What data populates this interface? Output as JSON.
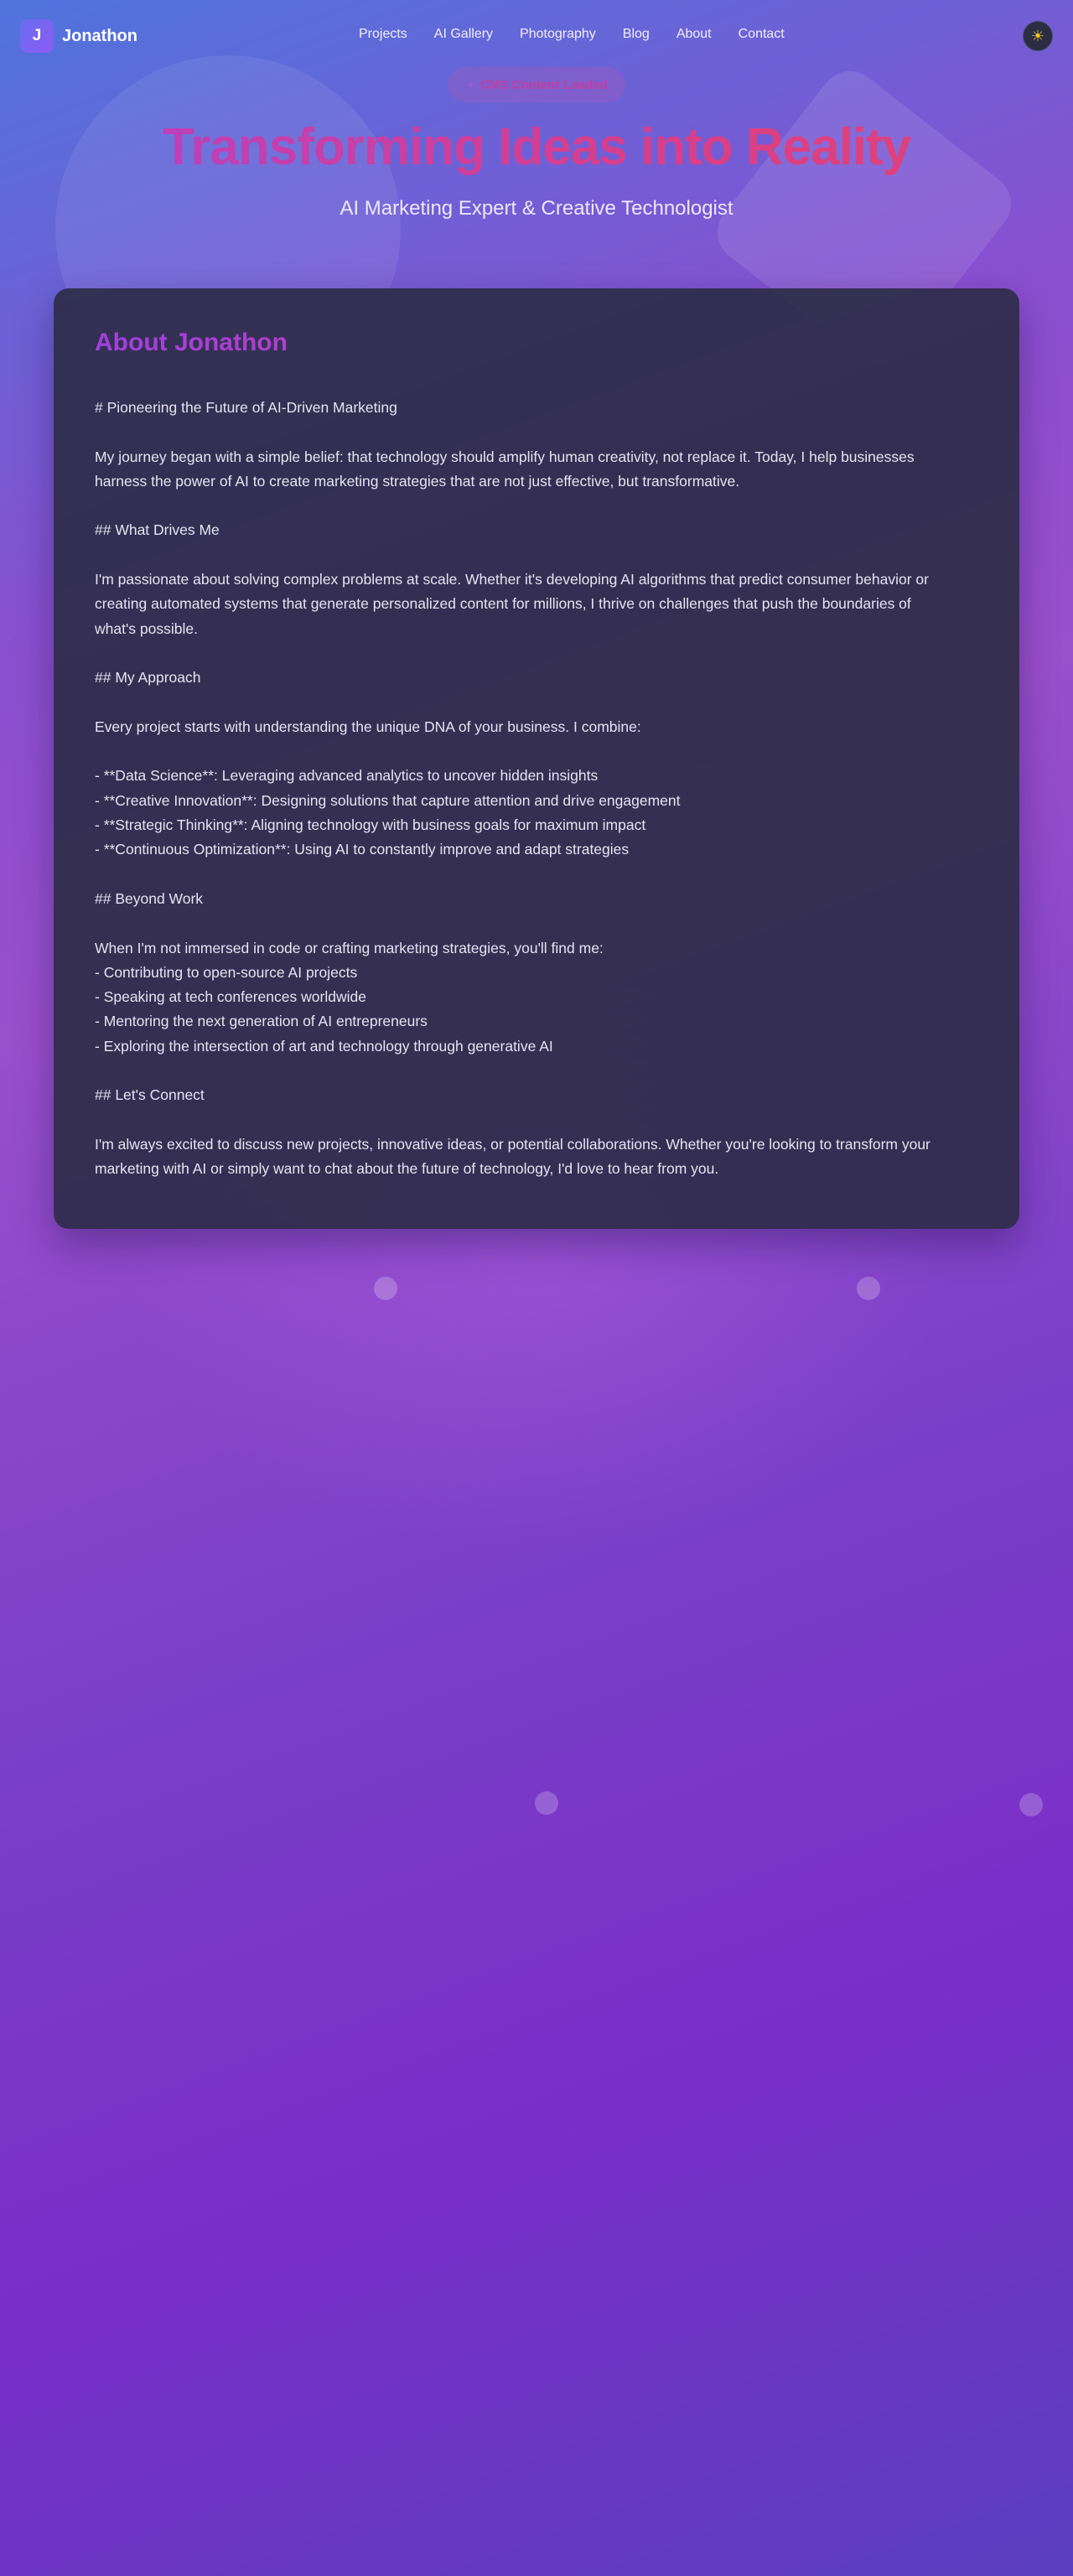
{
  "brand": {
    "logo_letter": "J",
    "name": "Jonathon"
  },
  "nav": {
    "links": [
      "Projects",
      "AI Gallery",
      "Photography",
      "Blog",
      "About",
      "Contact"
    ],
    "theme_icon": "sun-icon"
  },
  "badge": {
    "icon": "sparkle-icon",
    "text": "CMS Content Loaded"
  },
  "hero": {
    "title": "Transforming Ideas into Reality",
    "subtitle": "AI Marketing Expert & Creative Technologist"
  },
  "about": {
    "title": "About Jonathon",
    "lines": [
      "# Pioneering the Future of AI-Driven Marketing",
      "",
      "My journey began with a simple belief: that technology should amplify human creativity, not replace it. Today, I help businesses",
      "harness the power of AI to create marketing strategies that are not just effective, but transformative.",
      "",
      "## What Drives Me",
      "",
      "I'm passionate about solving complex problems at scale. Whether it's developing AI algorithms that predict consumer behavior or",
      "creating automated systems that generate personalized content for millions, I thrive on challenges that push the boundaries of",
      "what's possible.",
      "",
      "## My Approach",
      "",
      "Every project starts with understanding the unique DNA of your business. I combine:",
      "",
      "- **Data Science**: Leveraging advanced analytics to uncover hidden insights",
      "- **Creative Innovation**: Designing solutions that capture attention and drive engagement",
      "- **Strategic Thinking**: Aligning technology with business goals for maximum impact",
      "- **Continuous Optimization**: Using AI to constantly improve and adapt strategies",
      "",
      "## Beyond Work",
      "",
      "When I'm not immersed in code or crafting marketing strategies, you'll find me:",
      "- Contributing to open-source AI projects",
      "- Speaking at tech conferences worldwide",
      "- Mentoring the next generation of AI entrepreneurs",
      "- Exploring the intersection of art and technology through generative AI",
      "",
      "## Let's Connect",
      "",
      "I'm always excited to discuss new projects, innovative ideas, or potential collaborations. Whether you're looking to transform your",
      "marketing with AI or simply want to chat about the future of technology, I'd love to hear from you."
    ]
  }
}
